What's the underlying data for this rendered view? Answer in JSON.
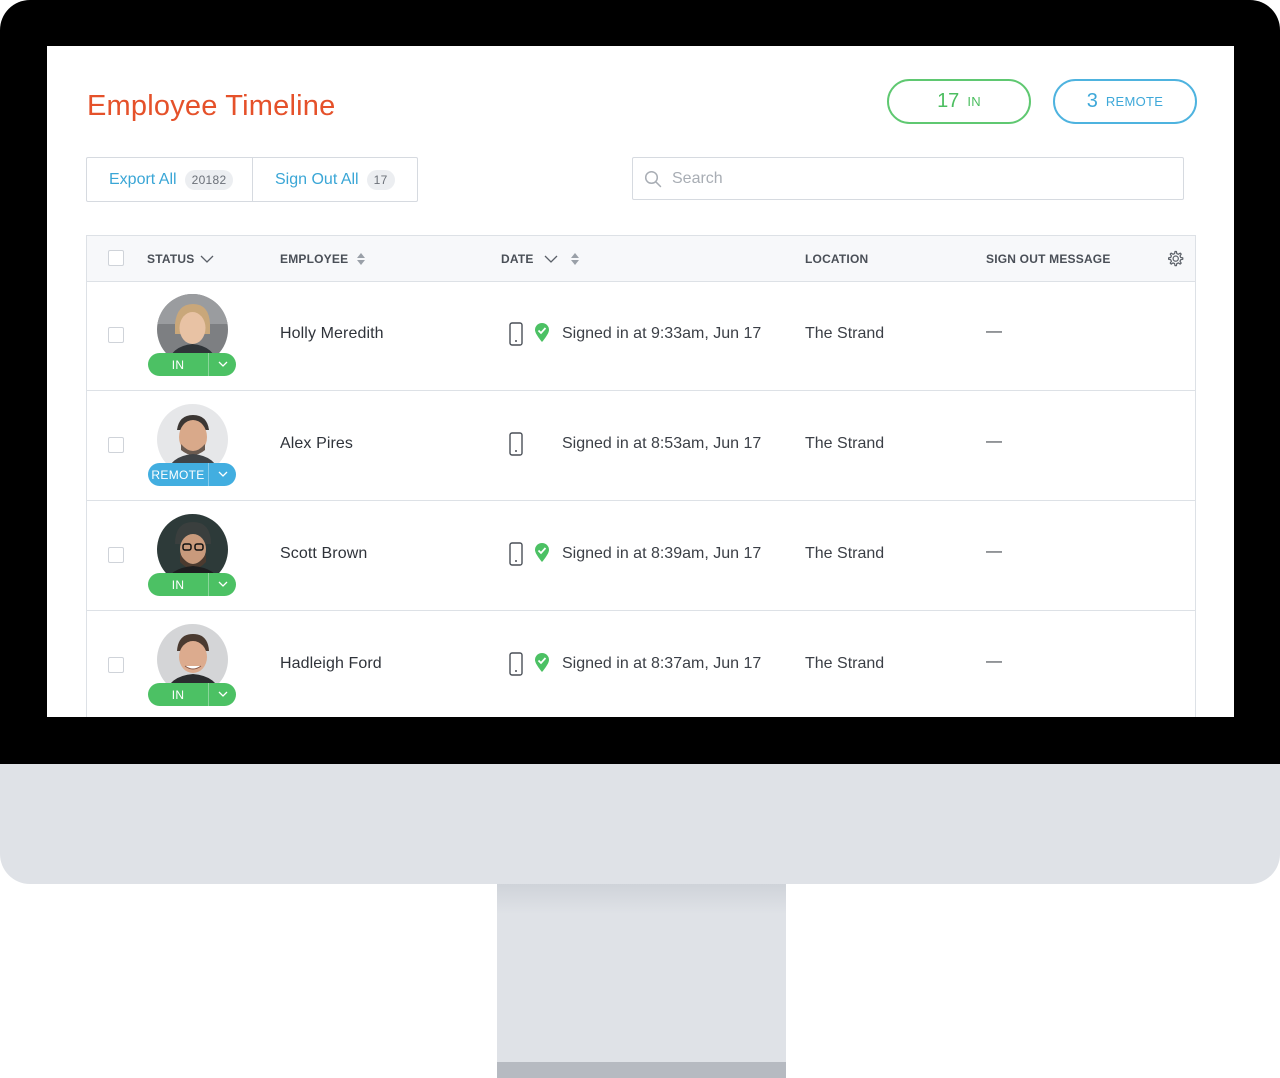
{
  "header": {
    "title": "Employee Timeline",
    "in_count": "17",
    "in_label": "IN",
    "remote_count": "3",
    "remote_label": "REMOTE"
  },
  "actions": {
    "export_label": "Export All",
    "export_count": "20182",
    "signout_label": "Sign Out All",
    "signout_count": "17"
  },
  "search": {
    "placeholder": "Search",
    "icon": "search-icon"
  },
  "table": {
    "columns": {
      "status": "STATUS",
      "employee": "EMPLOYEE",
      "date": "DATE",
      "location": "LOCATION",
      "sign_out_message": "SIGN OUT MESSAGE"
    },
    "rows": [
      {
        "status": "IN",
        "name": "Holly Meredith",
        "date": "Signed in at 9:33am, Jun 17",
        "location": "The Strand",
        "message": "—",
        "verified": true
      },
      {
        "status": "REMOTE",
        "name": "Alex Pires",
        "date": "Signed in at 8:53am, Jun 17",
        "location": "The Strand",
        "message": "—",
        "verified": false
      },
      {
        "status": "IN",
        "name": "Scott Brown",
        "date": "Signed in at 8:39am, Jun 17",
        "location": "The Strand",
        "message": "—",
        "verified": true
      },
      {
        "status": "IN",
        "name": "Hadleigh Ford",
        "date": "Signed in at 8:37am, Jun 17",
        "location": "The Strand",
        "message": "—",
        "verified": true
      }
    ]
  },
  "colors": {
    "title": "#e5512a",
    "in_green": "#4cc164",
    "remote_blue": "#42aee0",
    "link_blue": "#3aa6d6"
  }
}
